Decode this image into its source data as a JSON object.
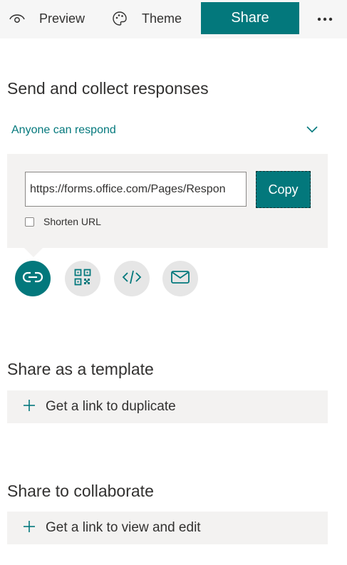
{
  "topbar": {
    "preview_label": "Preview",
    "preview_icon": "eye-icon",
    "theme_label": "Theme",
    "theme_icon": "palette-icon",
    "share_label": "Share",
    "more_icon": "more-ellipsis-icon"
  },
  "send": {
    "title": "Send and collect responses",
    "audience_label": "Anyone can respond",
    "url_value": "https://forms.office.com/Pages/Respon",
    "copy_label": "Copy",
    "shorten_label": "Shorten URL",
    "shorten_checked": false,
    "share_methods": [
      {
        "icon": "link-icon",
        "active": true
      },
      {
        "icon": "qr-code-icon",
        "active": false
      },
      {
        "icon": "embed-code-icon",
        "active": false
      },
      {
        "icon": "email-icon",
        "active": false
      }
    ]
  },
  "template": {
    "title": "Share as a template",
    "action_label": "Get a link to duplicate"
  },
  "collaborate": {
    "title": "Share to collaborate",
    "action_label": "Get a link to view and edit"
  },
  "colors": {
    "accent": "#03787c",
    "topbar_bg": "#f6f6f6",
    "panel_bg": "#f3f2f1",
    "icon_circle_bg": "#e6e6e6",
    "text": "#323130"
  }
}
